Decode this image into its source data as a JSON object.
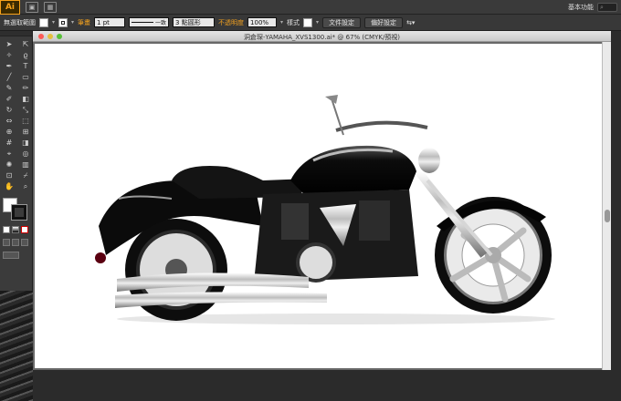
{
  "menubar": {
    "app_logo": "Ai",
    "workspace_label": "基本功能",
    "icons": [
      "bridge-icon",
      "arrange-icon"
    ]
  },
  "control_bar": {
    "selection_label": "無選取範圍",
    "stroke_label": "筆畫",
    "stroke_weight": "1 pt",
    "stroke_profile": "一致",
    "brush_label": "3 點圓形",
    "opacity_label": "不透明度",
    "opacity_value": "100%",
    "style_label": "樣式",
    "doc_setup_button": "文件設定",
    "preferences_button": "偏好設定"
  },
  "document": {
    "title": "洞倉琛-YAMAHA_XVS1300.ai* @ 67% (CMYK/預視)"
  },
  "colors": {
    "accent": "#f7a21b",
    "canvas": "#ffffff",
    "pasteboard": "#686868",
    "panel": "#3b3b3b"
  },
  "tools": [
    "selection-tool-icon",
    "direct-selection-tool-icon",
    "magic-wand-tool-icon",
    "lasso-tool-icon",
    "pen-tool-icon",
    "type-tool-icon",
    "line-tool-icon",
    "rectangle-tool-icon",
    "paintbrush-tool-icon",
    "pencil-tool-icon",
    "blob-brush-tool-icon",
    "eraser-tool-icon",
    "rotate-tool-icon",
    "scale-tool-icon",
    "width-tool-icon",
    "free-transform-tool-icon",
    "shape-builder-tool-icon",
    "perspective-grid-tool-icon",
    "mesh-tool-icon",
    "gradient-tool-icon",
    "eyedropper-tool-icon",
    "blend-tool-icon",
    "symbol-sprayer-tool-icon",
    "column-graph-tool-icon",
    "artboard-tool-icon",
    "slice-tool-icon",
    "hand-tool-icon",
    "zoom-tool-icon"
  ]
}
